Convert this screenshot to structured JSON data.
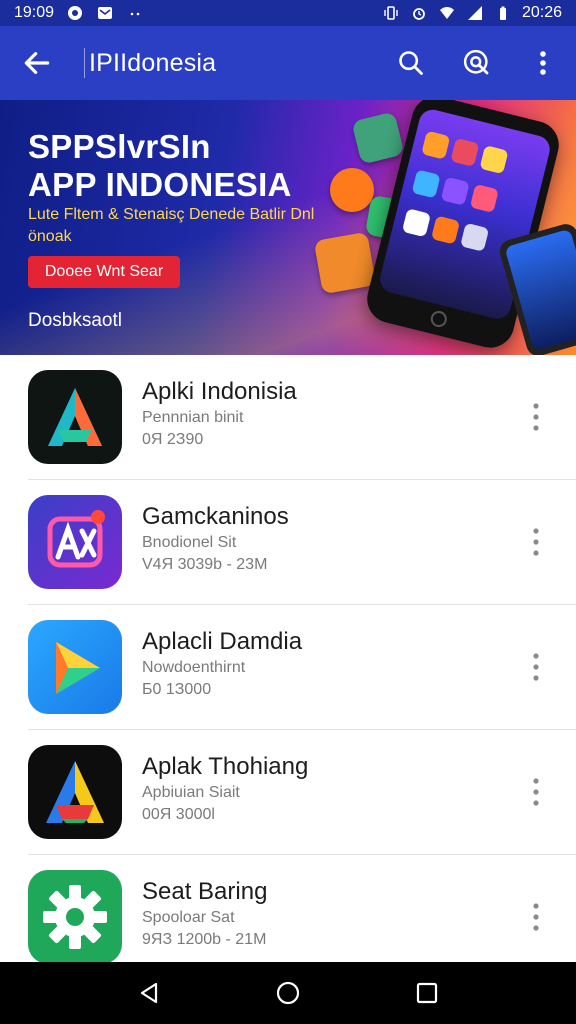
{
  "status_bar": {
    "time": "19:09",
    "right_time": "20:26",
    "left_icons": [
      "record-icon",
      "mail-icon",
      "dots-icon"
    ],
    "right_icons": [
      "vibrate-icon",
      "alarm-icon",
      "wifi-icon",
      "signal-icon",
      "battery-icon"
    ]
  },
  "app_bar": {
    "title": "IPIIdonesia",
    "back_icon": "arrow-left-icon",
    "actions": [
      "search-icon",
      "search-alt-icon",
      "more-vert-icon"
    ]
  },
  "banner": {
    "headline_line1": "SPPSlvrSIn",
    "headline_line2": "APP INDONESIA",
    "subtitle": "Lute Fltem & Stenaisç Denede Batlir Dnl önoak",
    "button_label": "Dooee Wnt Sear",
    "footer": "Dosbksaotl"
  },
  "apps": [
    {
      "name": "Aplki Indonisia",
      "line1": "Pennnian binit",
      "line2": "0Я 2З90",
      "icon": "aplki-app-icon"
    },
    {
      "name": "Gamckaninos",
      "line1": "Bnodionel Sit",
      "line2": "V4Я 3039b - 23M",
      "icon": "gamckaninos-app-icon"
    },
    {
      "name": "Aplacli Damdia",
      "line1": "Nowdoenthirnt",
      "line2": "Б0 1З000",
      "icon": "aplacli-app-icon"
    },
    {
      "name": "Aplak Thohiang",
      "line1": "Apbiuian Siait",
      "line2": "00Я 3000l",
      "icon": "aplak-app-icon"
    },
    {
      "name": "Seat Baring",
      "line1": "Spooloar Sat",
      "line2": "9ЯЗ 1200b - 21M",
      "icon": "settings-app-icon"
    }
  ],
  "nav_bar": [
    "back-triangle-icon",
    "home-circle-icon",
    "recents-square-icon"
  ],
  "colors": {
    "status_bar": "#1b2c9c",
    "app_bar": "#2a3fc4",
    "banner_button": "#e32434",
    "banner_subtitle": "#ffd84a"
  }
}
